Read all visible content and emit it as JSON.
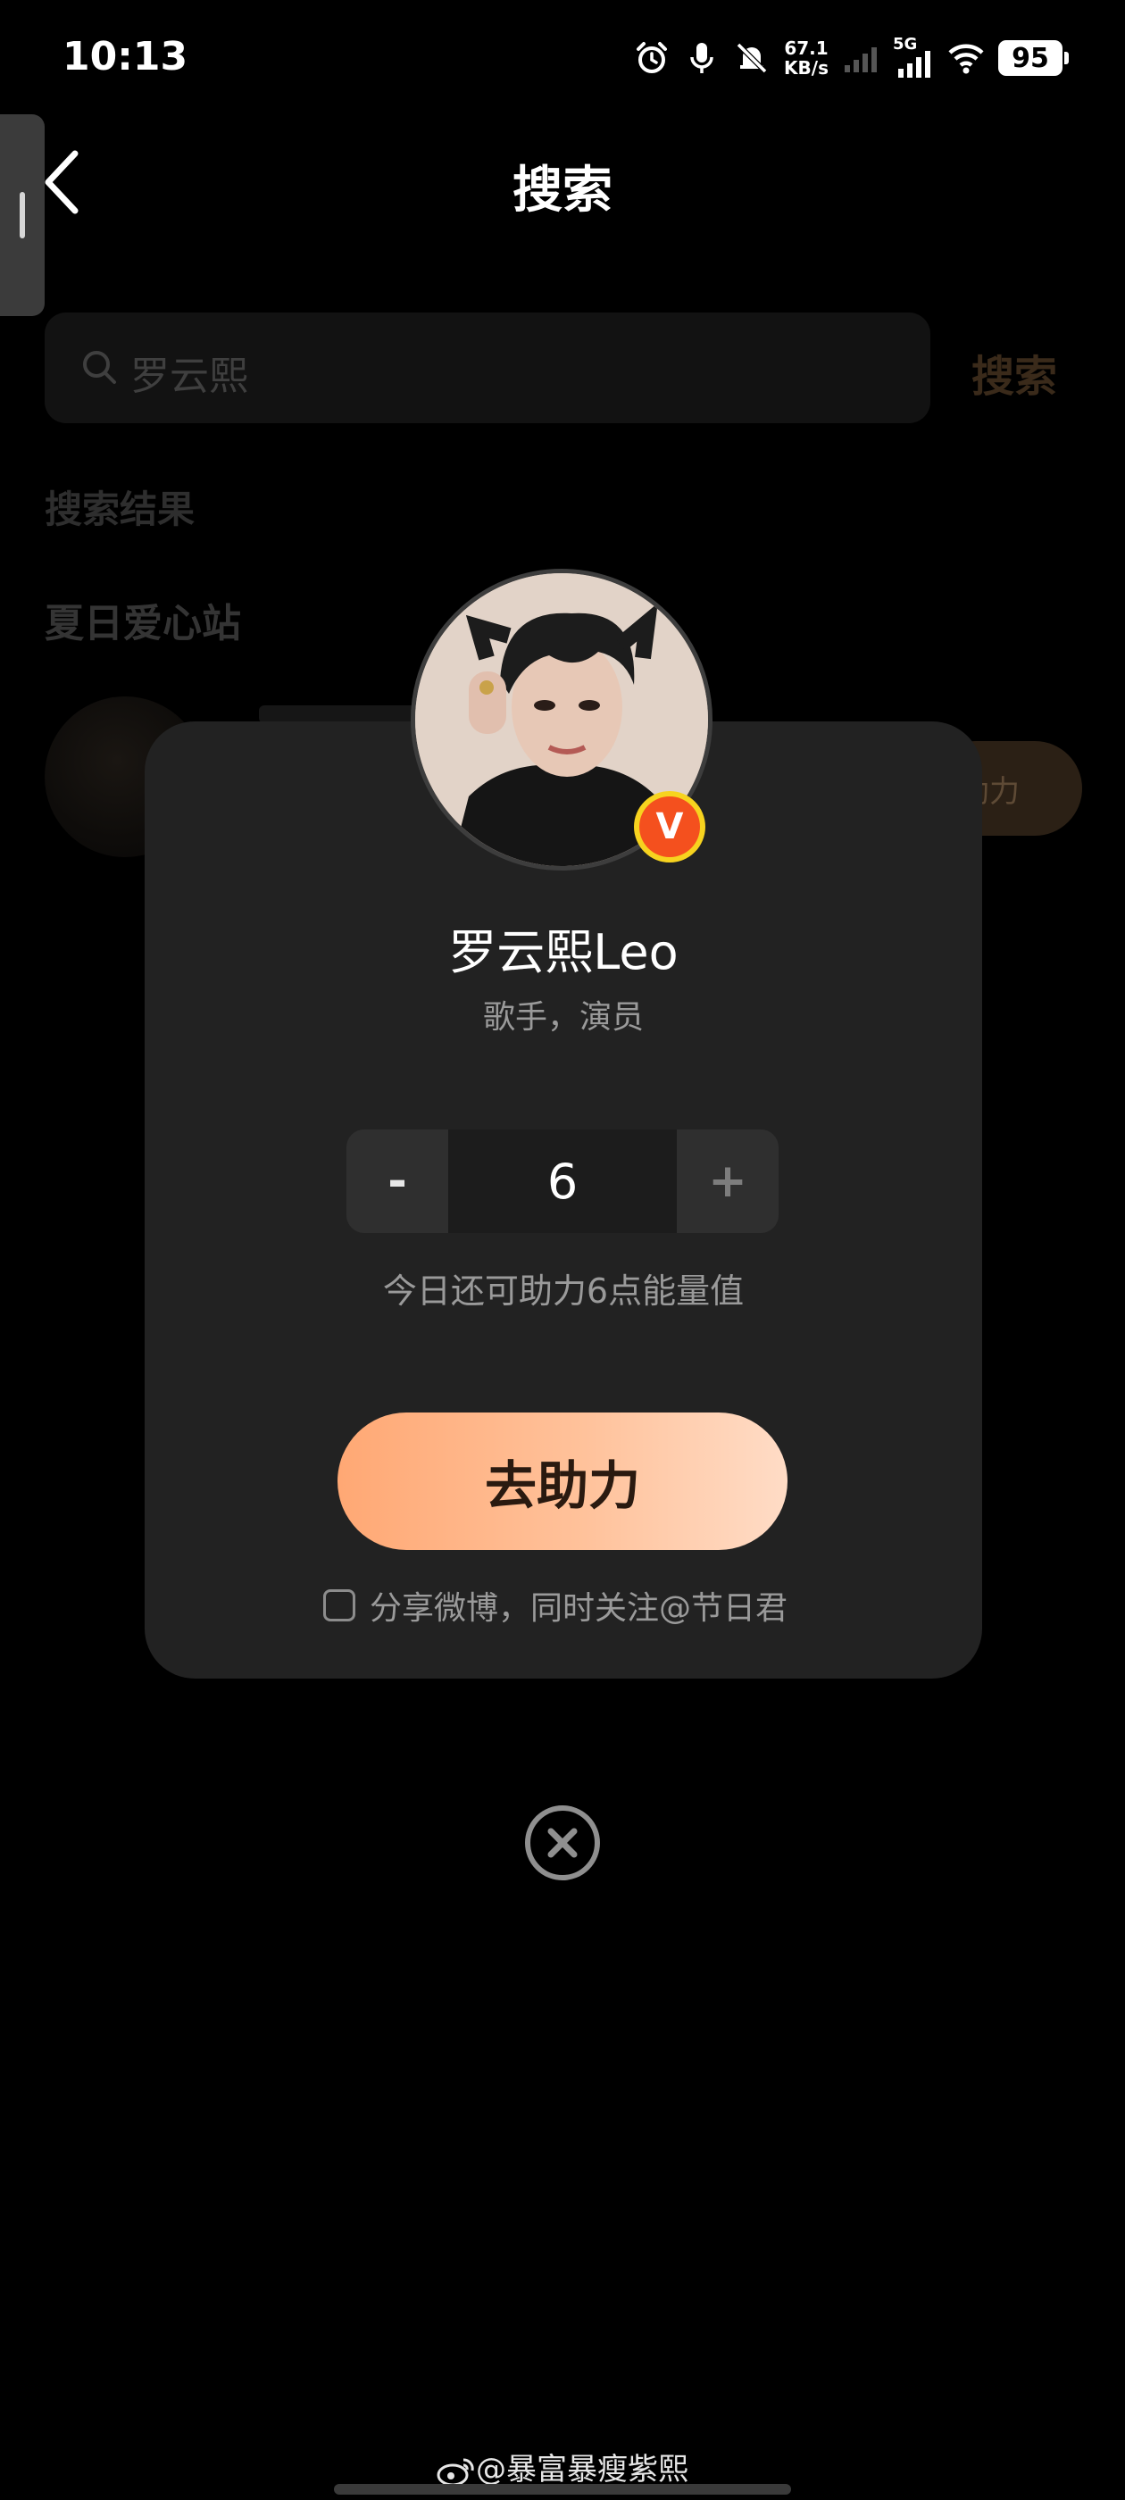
{
  "status_bar": {
    "time": "10:13",
    "net_speed_value": "67.1",
    "net_speed_unit": "KB/s",
    "network_type": "5G",
    "battery": "95"
  },
  "nav": {
    "title": "搜索"
  },
  "background_page": {
    "search_query": "罗云熙",
    "search_button": "搜索",
    "results_label": "搜索结果",
    "section_title": "夏日爱心站",
    "help_button": "助力"
  },
  "dialog": {
    "name": "罗云熙Leo",
    "description": "歌手，演员",
    "verified_label": "V",
    "stepper": {
      "minus": "-",
      "value": "6",
      "plus": "+"
    },
    "remaining_text": "今日还可助力6点能量值",
    "assist_button": "去助力",
    "share_label": "分享微博，同时关注@节日君",
    "share_checked": false
  },
  "watermark": "@暴富暴瘦紫熙",
  "colors": {
    "background": "#000000",
    "dialog": "#222222",
    "accent_start": "#ffa874",
    "accent_end": "#ffdcc6",
    "badge_outer": "#f7d31f",
    "badge_inner": "#f4501e"
  }
}
